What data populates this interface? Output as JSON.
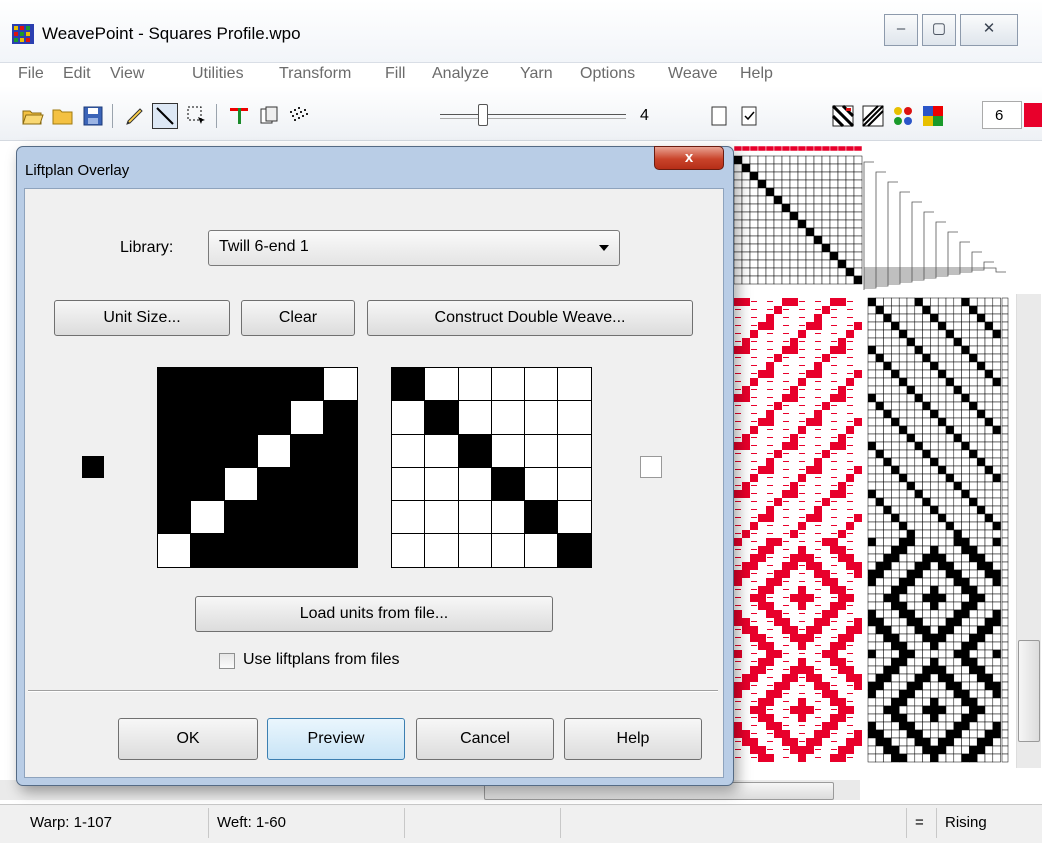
{
  "window": {
    "title": "WeavePoint - Squares Profile.wpo",
    "min_glyph": "–",
    "max_glyph": "▢",
    "close_glyph": "✕"
  },
  "menu": [
    "File",
    "Edit",
    "View",
    "Utilities",
    "Transform",
    "Fill",
    "Analyze",
    "Yarn",
    "Options",
    "Weave",
    "Help"
  ],
  "toolbar": {
    "zoom_level": "4",
    "color_number": "6",
    "accent_color": "#e8002b"
  },
  "dialog": {
    "title": "Liftplan Overlay",
    "close_glyph": "x",
    "library_label": "Library:",
    "library_value": "Twill 6-end 1",
    "unit_size_button": "Unit Size...",
    "clear_button": "Clear",
    "double_weave_button": "Construct Double Weave...",
    "load_units_button": "Load units from file...",
    "use_liftplans_label": "Use liftplans from files",
    "use_liftplans_checked": false,
    "ok_button": "OK",
    "preview_button": "Preview",
    "cancel_button": "Cancel",
    "help_button": "Help",
    "unit_a": [
      [
        1,
        1,
        1,
        1,
        1,
        0
      ],
      [
        1,
        1,
        1,
        1,
        0,
        1
      ],
      [
        1,
        1,
        1,
        0,
        1,
        1
      ],
      [
        1,
        1,
        0,
        1,
        1,
        1
      ],
      [
        1,
        0,
        1,
        1,
        1,
        1
      ],
      [
        0,
        1,
        1,
        1,
        1,
        1
      ]
    ],
    "unit_b": [
      [
        1,
        0,
        0,
        0,
        0,
        0
      ],
      [
        0,
        1,
        0,
        0,
        0,
        0
      ],
      [
        0,
        0,
        1,
        0,
        0,
        0
      ],
      [
        0,
        0,
        0,
        1,
        0,
        0
      ],
      [
        0,
        0,
        0,
        0,
        1,
        0
      ],
      [
        0,
        0,
        0,
        0,
        0,
        1
      ]
    ],
    "swatch_a_color": "#000000",
    "swatch_b_color": "#ffffff"
  },
  "status": {
    "warp": "Warp: 1-107",
    "weft": "Weft: 1-60",
    "equals": "=",
    "mode": "Rising"
  }
}
